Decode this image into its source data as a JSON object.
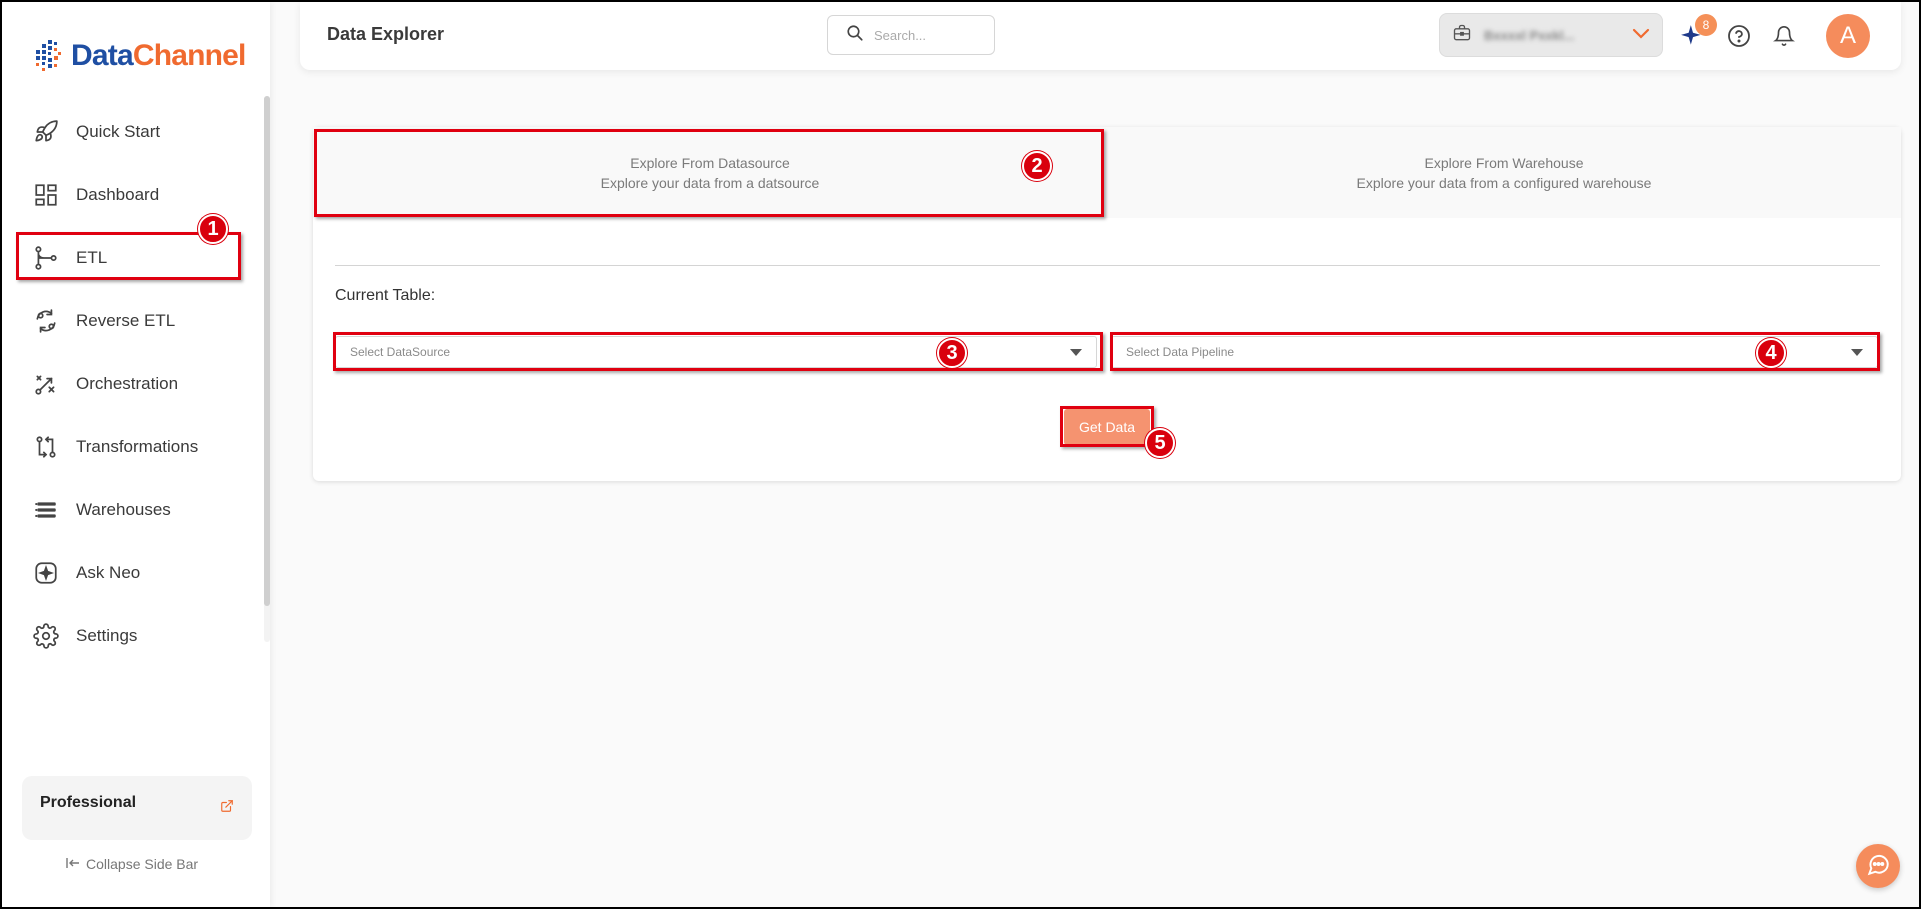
{
  "brand": {
    "name_part1": "Data",
    "name_part2": "Channel",
    "blue": "#1f4fa3",
    "orange": "#f06a2f"
  },
  "sidebar": {
    "items": [
      {
        "label": "Quick Start",
        "icon": "rocket-icon"
      },
      {
        "label": "Dashboard",
        "icon": "dashboard-grid-icon"
      },
      {
        "label": "ETL",
        "icon": "etl-flow-icon"
      },
      {
        "label": "Reverse ETL",
        "icon": "reverse-etl-icon"
      },
      {
        "label": "Orchestration",
        "icon": "orchestration-icon"
      },
      {
        "label": "Transformations",
        "icon": "transformations-icon"
      },
      {
        "label": "Warehouses",
        "icon": "warehouse-stack-icon"
      },
      {
        "label": "Ask Neo",
        "icon": "sparkle-box-icon"
      },
      {
        "label": "Settings",
        "icon": "gear-icon"
      }
    ],
    "plan": "Professional",
    "collapse_label": "Collapse Side Bar"
  },
  "header": {
    "title": "Data Explorer",
    "search_placeholder": "Search...",
    "workspace_name": "Bxxxxl Pxxkl...",
    "notifications_count": "8",
    "avatar_initial": "A"
  },
  "main": {
    "tabs": [
      {
        "title": "Explore From Datasource",
        "subtitle": "Explore your data from a datsource"
      },
      {
        "title": "Explore From Warehouse",
        "subtitle": "Explore your data from a configured warehouse"
      }
    ],
    "current_table_label": "Current Table:",
    "datasource_placeholder": "Select DataSource",
    "pipeline_placeholder": "Select Data Pipeline",
    "get_data_label": "Get Data"
  },
  "annotations": {
    "markers": [
      "1",
      "2",
      "3",
      "4",
      "5"
    ],
    "color": "#e00010"
  }
}
